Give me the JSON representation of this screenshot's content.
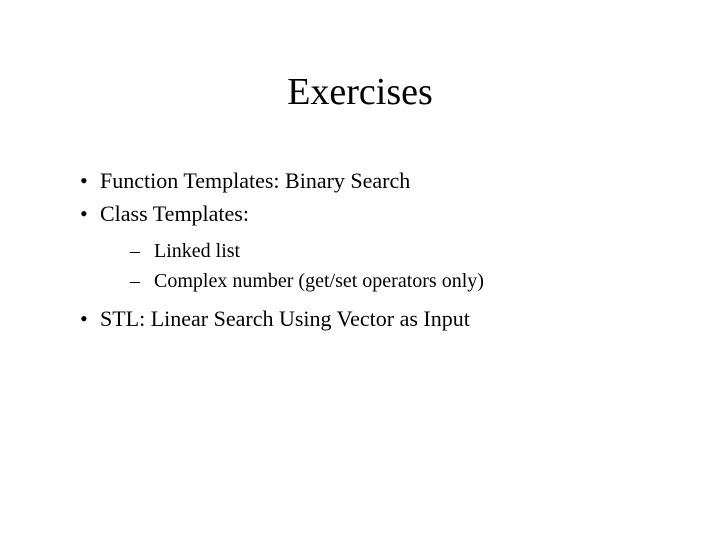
{
  "title": "Exercises",
  "bullets": [
    {
      "text": "Function Templates: Binary Search"
    },
    {
      "text": "Class Templates:"
    }
  ],
  "subitems": [
    {
      "text": "Linked list"
    },
    {
      "text": "Complex number (get/set operators only)"
    }
  ],
  "bullet3": "STL: Linear Search Using Vector as Input"
}
